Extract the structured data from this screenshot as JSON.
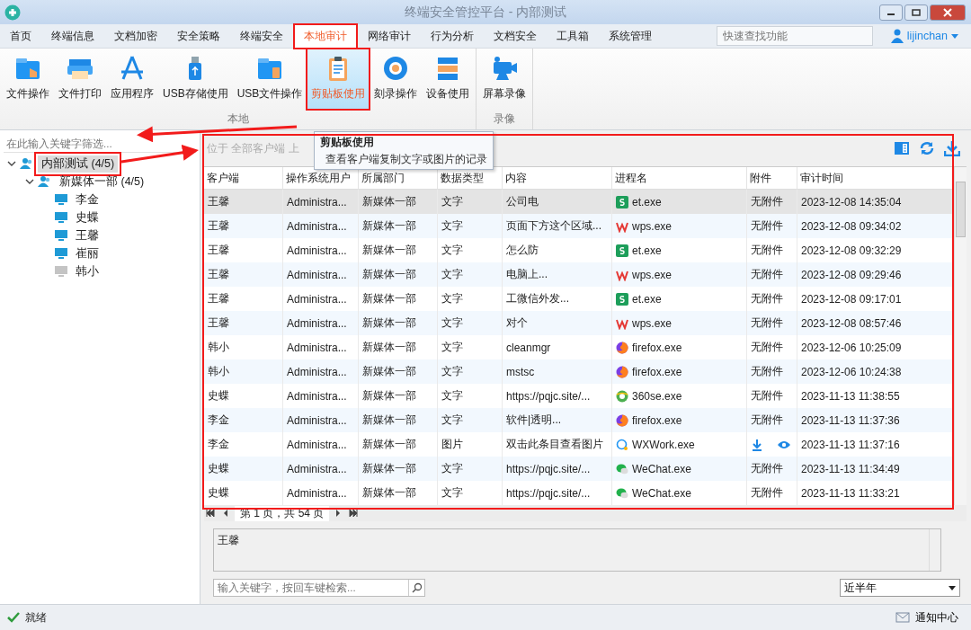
{
  "window": {
    "title": "终端安全管控平台 - 内部测试"
  },
  "menu": [
    {
      "label": "首页",
      "selected": false
    },
    {
      "label": "终端信息",
      "selected": false
    },
    {
      "label": "文档加密",
      "selected": false
    },
    {
      "label": "安全策略",
      "selected": false
    },
    {
      "label": "终端安全",
      "selected": false
    },
    {
      "label": "本地审计",
      "selected": true
    },
    {
      "label": "网络审计",
      "selected": false
    },
    {
      "label": "行为分析",
      "selected": false
    },
    {
      "label": "文档安全",
      "selected": false
    },
    {
      "label": "工具箱",
      "selected": false
    },
    {
      "label": "系统管理",
      "selected": false
    }
  ],
  "quick_search": {
    "placeholder": "快速查找功能"
  },
  "user": {
    "name": "lijinchan"
  },
  "ribbon": [
    {
      "group": "本地",
      "items": [
        {
          "label": "文件操作",
          "selected": false
        },
        {
          "label": "文件打印",
          "selected": false
        },
        {
          "label": "应用程序",
          "selected": false
        },
        {
          "label": "USB存储使用",
          "selected": false
        },
        {
          "label": "USB文件操作",
          "selected": false
        },
        {
          "label": "剪贴板使用",
          "selected": true
        },
        {
          "label": "刻录操作",
          "selected": false
        },
        {
          "label": "设备使用",
          "selected": false
        }
      ]
    },
    {
      "group": "录像",
      "items": [
        {
          "label": "屏幕录像",
          "selected": false
        }
      ]
    }
  ],
  "sidebar": {
    "filter": {
      "placeholder": "在此输入关键字筛选..."
    },
    "tree": [
      {
        "label": "内部测试 (4/5)",
        "selected": true,
        "expanded": true,
        "children": [
          {
            "label": "新媒体一部 (4/5)",
            "selected": false,
            "expanded": true,
            "children": [
              {
                "label": "李金",
                "selected": false,
                "online": true
              },
              {
                "label": "史蝶",
                "selected": false,
                "online": true
              },
              {
                "label": "王馨",
                "selected": false,
                "online": true
              },
              {
                "label": "崔丽",
                "selected": false,
                "online": true
              },
              {
                "label": "韩小",
                "selected": false,
                "online": false
              }
            ]
          }
        ]
      }
    ]
  },
  "location": {
    "text": "位于 全部客户端 上"
  },
  "tooltip": {
    "title": "剪贴板使用",
    "text": "查看客户端复制文字或图片的记录"
  },
  "table": {
    "columns": [
      "客户端",
      "操作系统用户",
      "所属部门",
      "数据类型",
      "内容",
      "进程名",
      "附件",
      "审计时间"
    ],
    "rows": [
      {
        "selected": true,
        "client": "王馨",
        "user": "Administra...",
        "dept": "新媒体一部",
        "type": "文字",
        "content": "公司电",
        "process": {
          "name": "et.exe",
          "kind": "sheet"
        },
        "attachment": {
          "kind": "none",
          "label": "无附件"
        },
        "time": "2023-12-08 14:35:04"
      },
      {
        "selected": false,
        "client": "王馨",
        "user": "Administra...",
        "dept": "新媒体一部",
        "type": "文字",
        "content": "页面下方这个区域...",
        "process": {
          "name": "wps.exe",
          "kind": "writer"
        },
        "attachment": {
          "kind": "none",
          "label": "无附件"
        },
        "time": "2023-12-08 09:34:02"
      },
      {
        "selected": false,
        "client": "王馨",
        "user": "Administra...",
        "dept": "新媒体一部",
        "type": "文字",
        "content": "怎么防",
        "process": {
          "name": "et.exe",
          "kind": "sheet"
        },
        "attachment": {
          "kind": "none",
          "label": "无附件"
        },
        "time": "2023-12-08 09:32:29"
      },
      {
        "selected": false,
        "client": "王馨",
        "user": "Administra...",
        "dept": "新媒体一部",
        "type": "文字",
        "content": "电脑上...",
        "process": {
          "name": "wps.exe",
          "kind": "writer"
        },
        "attachment": {
          "kind": "none",
          "label": "无附件"
        },
        "time": "2023-12-08 09:29:46"
      },
      {
        "selected": false,
        "client": "王馨",
        "user": "Administra...",
        "dept": "新媒体一部",
        "type": "文字",
        "content": "工微信外发...",
        "process": {
          "name": "et.exe",
          "kind": "sheet"
        },
        "attachment": {
          "kind": "none",
          "label": "无附件"
        },
        "time": "2023-12-08 09:17:01"
      },
      {
        "selected": false,
        "client": "王馨",
        "user": "Administra...",
        "dept": "新媒体一部",
        "type": "文字",
        "content": "对个",
        "process": {
          "name": "wps.exe",
          "kind": "writer"
        },
        "attachment": {
          "kind": "none",
          "label": "无附件"
        },
        "time": "2023-12-08 08:57:46"
      },
      {
        "selected": false,
        "client": "韩小",
        "user": "Administra...",
        "dept": "新媒体一部",
        "type": "文字",
        "content": "cleanmgr",
        "process": {
          "name": "firefox.exe",
          "kind": "firefox"
        },
        "attachment": {
          "kind": "none",
          "label": "无附件"
        },
        "time": "2023-12-06 10:25:09"
      },
      {
        "selected": false,
        "client": "韩小",
        "user": "Administra...",
        "dept": "新媒体一部",
        "type": "文字",
        "content": "mstsc",
        "process": {
          "name": "firefox.exe",
          "kind": "firefox"
        },
        "attachment": {
          "kind": "none",
          "label": "无附件"
        },
        "time": "2023-12-06 10:24:38"
      },
      {
        "selected": false,
        "client": "史蝶",
        "user": "Administra...",
        "dept": "新媒体一部",
        "type": "文字",
        "content": "https://pqjc.site/...",
        "process": {
          "name": "360se.exe",
          "kind": "browser360"
        },
        "attachment": {
          "kind": "none",
          "label": "无附件"
        },
        "time": "2023-11-13 11:38:55"
      },
      {
        "selected": false,
        "client": "李金",
        "user": "Administra...",
        "dept": "新媒体一部",
        "type": "文字",
        "content": "软件|透明...",
        "process": {
          "name": "firefox.exe",
          "kind": "firefox"
        },
        "attachment": {
          "kind": "none",
          "label": "无附件"
        },
        "time": "2023-11-13 11:37:36"
      },
      {
        "selected": false,
        "client": "李金",
        "user": "Administra...",
        "dept": "新媒体一部",
        "type": "图片",
        "content": "双击此条目查看图片",
        "process": {
          "name": "WXWork.exe",
          "kind": "wxwork"
        },
        "attachment": {
          "kind": "image"
        },
        "time": "2023-11-13 11:37:16"
      },
      {
        "selected": false,
        "client": "史蝶",
        "user": "Administra...",
        "dept": "新媒体一部",
        "type": "文字",
        "content": "https://pqjc.site/...",
        "process": {
          "name": "WeChat.exe",
          "kind": "wechat"
        },
        "attachment": {
          "kind": "none",
          "label": "无附件"
        },
        "time": "2023-11-13 11:34:49"
      },
      {
        "selected": false,
        "client": "史蝶",
        "user": "Administra...",
        "dept": "新媒体一部",
        "type": "文字",
        "content": "https://pqjc.site/...",
        "process": {
          "name": "WeChat.exe",
          "kind": "wechat"
        },
        "attachment": {
          "kind": "none",
          "label": "无附件"
        },
        "time": "2023-11-13 11:33:21"
      }
    ]
  },
  "pager": {
    "text": "第 1 页，共 54 页"
  },
  "detail": {
    "text": "王馨"
  },
  "search": {
    "placeholder": "输入关键字，按回车键检索..."
  },
  "period": {
    "value": "近半年"
  },
  "status_bar": {
    "status": "就绪",
    "notifications": "通知中心"
  }
}
